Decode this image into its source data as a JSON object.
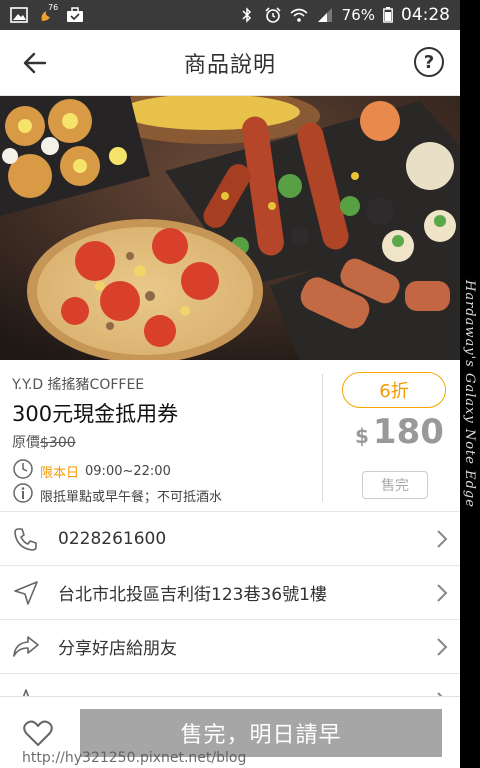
{
  "status_bar": {
    "notif_badge": "76",
    "battery": "76%",
    "time": "04:28"
  },
  "header": {
    "title": "商品說明",
    "help_glyph": "?"
  },
  "product": {
    "shop": "Y.Y.D 搖搖豬COFFEE",
    "name": "300元現金抵用券",
    "original_label": "原價",
    "original_price": "$300",
    "days_label": "限本日",
    "hours": "09:00~22:00",
    "note": "限抵單點或早午餐；不可抵酒水",
    "discount": "6折",
    "currency": "$",
    "price": "180",
    "sold_out_label": "售完"
  },
  "details": [
    {
      "icon": "phone-icon",
      "text": "0228261600"
    },
    {
      "icon": "location-arrow-icon",
      "text": "台北市北投區吉利街123巷36號1樓"
    },
    {
      "icon": "share-icon",
      "text": "分享好店給朋友"
    }
  ],
  "bottom": {
    "cta_label": "售完，明日請早",
    "watermark_url": "http://hy321250.pixnet.net/blog"
  },
  "side_watermark": "Hardaway's Galaxy Note Edge",
  "colors": {
    "accent": "#f39a00",
    "cta_disabled": "#a6a6a6",
    "statusbar": "#3a3a3a"
  }
}
